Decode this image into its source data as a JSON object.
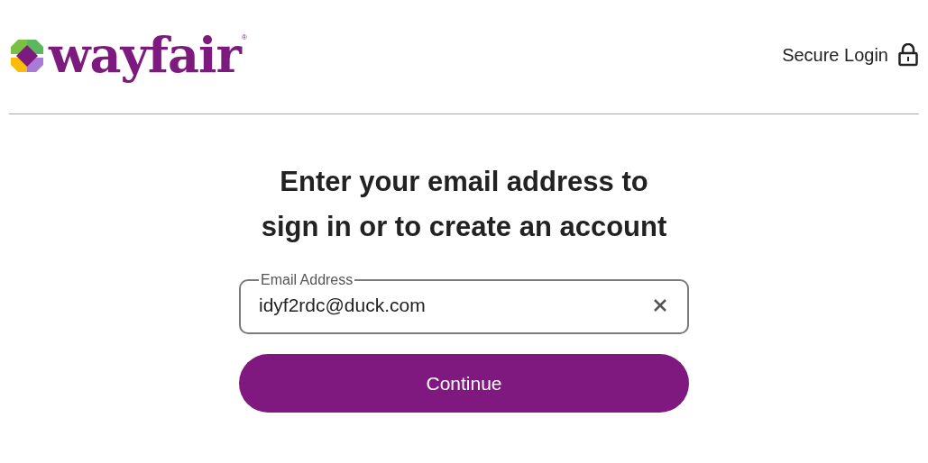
{
  "header": {
    "logo_text": "wayfair",
    "registered_mark": "®",
    "secure_login": "Secure Login"
  },
  "heading": [
    "Enter your email address to",
    "sign in or to create an account"
  ],
  "email_field": {
    "label": "Email Address",
    "value": "idyf2rdc@duck.com"
  },
  "buttons": [
    "Continue"
  ]
}
